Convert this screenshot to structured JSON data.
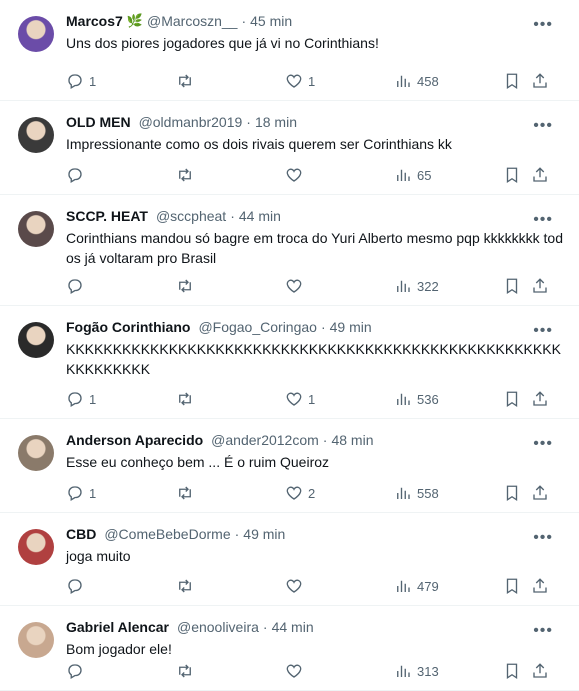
{
  "tweets": [
    {
      "name": "Marcos7",
      "badge": "🌿",
      "handle": "@Marcoszn__",
      "time": "45 min",
      "text": "Uns dos piores jogadores que já vi no Corinthians!",
      "replies": "1",
      "retweets": "",
      "likes": "1",
      "views": "458",
      "avatar_color": "#6b4ca8"
    },
    {
      "name": "OLD MEN",
      "badge": "",
      "handle": "@oldmanbr2019",
      "time": "18 min",
      "text": "Impressionante como os dois rivais querem ser Corinthians kk",
      "replies": "",
      "retweets": "",
      "likes": "",
      "views": "65",
      "avatar_color": "#3a3a3a"
    },
    {
      "name": "SCCP. HEAT",
      "badge": "",
      "handle": "@sccpheat",
      "time": "44 min",
      "text": "Corinthians mandou só bagre em troca do Yuri Alberto mesmo pqp kkkkkkkk todos já voltaram pro Brasil",
      "replies": "",
      "retweets": "",
      "likes": "",
      "views": "322",
      "avatar_color": "#5a4a4a"
    },
    {
      "name": "Fogão Corinthiano",
      "badge": "",
      "handle": "@Fogao_Coringao",
      "time": "49 min",
      "text": "KKKKKKKKKKKKKKKKKKKKKKKKKKKKKKKKKKKKKKKKKKKKKKKKKKKKKKKKKKKKKK",
      "replies": "1",
      "retweets": "",
      "likes": "1",
      "views": "536",
      "avatar_color": "#2a2a2a"
    },
    {
      "name": "Anderson Aparecido",
      "badge": "",
      "handle": "@ander2012com",
      "time": "48 min",
      "text": "Esse eu conheço bem ... É o ruim Queiroz",
      "replies": "1",
      "retweets": "",
      "likes": "2",
      "views": "558",
      "avatar_color": "#8a7a6a"
    },
    {
      "name": "CBD",
      "badge": "",
      "handle": "@ComeBebeDorme",
      "time": "49 min",
      "text": "joga muito",
      "replies": "",
      "retweets": "",
      "likes": "",
      "views": "479",
      "avatar_color": "#b04040"
    },
    {
      "name": "Gabriel Alencar",
      "badge": "",
      "handle": "@enooliveira",
      "time": "44 min",
      "text": "Bom jogador ele!",
      "replies": "",
      "retweets": "",
      "likes": "",
      "views": "313",
      "avatar_color": "#c8a890"
    }
  ],
  "more_label": "•••"
}
